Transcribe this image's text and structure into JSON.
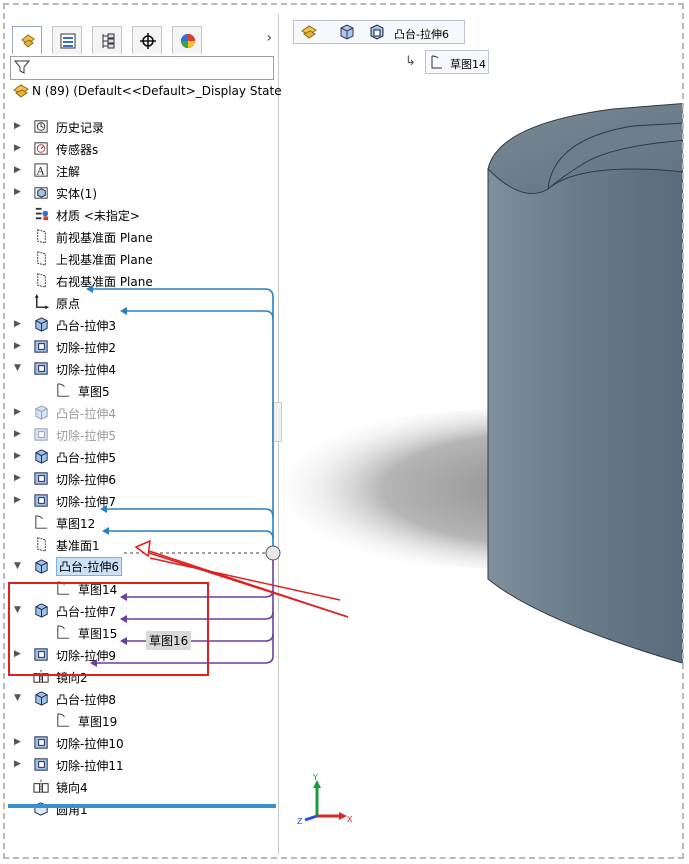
{
  "root": {
    "label": "N (89)  (Default<<Default>_Display State"
  },
  "tree": [
    {
      "label": "历史记录",
      "icon": "history-icon",
      "arrow": "right",
      "depth": 0
    },
    {
      "label": "传感器s",
      "icon": "sensor-icon",
      "arrow": "right",
      "depth": 0
    },
    {
      "label": "注解",
      "icon": "annotation-icon",
      "arrow": "right",
      "depth": 0
    },
    {
      "label": "实体(1)",
      "icon": "solid-body-icon",
      "arrow": "right",
      "depth": 0
    },
    {
      "label": "材质 <未指定>",
      "icon": "material-icon",
      "arrow": "none",
      "depth": 0
    },
    {
      "label": "前视基准面 Plane",
      "icon": "plane-icon",
      "arrow": "none",
      "depth": 0
    },
    {
      "label": "上视基准面 Plane",
      "icon": "plane-icon",
      "arrow": "none",
      "depth": 0
    },
    {
      "label": "右视基准面 Plane",
      "icon": "plane-icon",
      "arrow": "none",
      "depth": 0
    },
    {
      "label": "原点",
      "icon": "origin-icon",
      "arrow": "none",
      "depth": 0
    },
    {
      "label": "凸台-拉伸3",
      "icon": "boss-extrude-icon",
      "arrow": "right",
      "depth": 0
    },
    {
      "label": "切除-拉伸2",
      "icon": "cut-extrude-icon",
      "arrow": "right",
      "depth": 0
    },
    {
      "label": "切除-拉伸4",
      "icon": "cut-extrude-icon",
      "arrow": "down",
      "depth": 0
    },
    {
      "label": "草图5",
      "icon": "sketch-icon",
      "arrow": "none",
      "depth": 1
    },
    {
      "label": "凸台-拉伸4",
      "icon": "boss-extrude-icon",
      "arrow": "right",
      "depth": 0,
      "dim": true
    },
    {
      "label": "切除-拉伸5",
      "icon": "cut-extrude-icon",
      "arrow": "right",
      "depth": 0,
      "dim": true
    },
    {
      "label": "凸台-拉伸5",
      "icon": "boss-extrude-icon",
      "arrow": "right",
      "depth": 0
    },
    {
      "label": "切除-拉伸6",
      "icon": "cut-extrude-icon",
      "arrow": "right",
      "depth": 0
    },
    {
      "label": "切除-拉伸7",
      "icon": "cut-extrude-icon",
      "arrow": "right",
      "depth": 0
    },
    {
      "label": "草图12",
      "icon": "sketch-icon",
      "arrow": "none",
      "depth": 0
    },
    {
      "label": "基准面1",
      "icon": "plane-icon",
      "arrow": "none",
      "depth": 0
    },
    {
      "label": "凸台-拉伸6",
      "icon": "boss-extrude-icon",
      "arrow": "down",
      "depth": 0,
      "selected": true
    },
    {
      "label": "草图14",
      "icon": "sketch-icon",
      "arrow": "none",
      "depth": 1
    },
    {
      "label": "凸台-拉伸7",
      "icon": "boss-extrude-icon",
      "arrow": "down",
      "depth": 0
    },
    {
      "label": "草图15",
      "icon": "sketch-icon",
      "arrow": "none",
      "depth": 1
    },
    {
      "label": "切除-拉伸9",
      "icon": "cut-extrude-icon",
      "arrow": "right",
      "depth": 0
    },
    {
      "label": "镜向2",
      "icon": "mirror-icon",
      "arrow": "none",
      "depth": 0
    },
    {
      "label": "凸台-拉伸8",
      "icon": "boss-extrude-icon",
      "arrow": "down",
      "depth": 0
    },
    {
      "label": "草图19",
      "icon": "sketch-icon",
      "arrow": "none",
      "depth": 1
    },
    {
      "label": "切除-拉伸10",
      "icon": "cut-extrude-icon",
      "arrow": "right",
      "depth": 0
    },
    {
      "label": "切除-拉伸11",
      "icon": "cut-extrude-icon",
      "arrow": "right",
      "depth": 0
    },
    {
      "label": "镜向4",
      "icon": "mirror-icon",
      "arrow": "none",
      "depth": 0
    },
    {
      "label": "圆角1",
      "icon": "fillet-icon",
      "arrow": "none",
      "depth": 0
    }
  ],
  "tooltip": "草图16",
  "breadcrumb": {
    "feature": "凸台-拉伸6",
    "sketch": "草图14"
  },
  "triad": {
    "x": "X",
    "y": "Y",
    "z": "Z"
  },
  "colors": {
    "accent_blue": "#2a7fc1",
    "accent_purple": "#6a3fa0",
    "highlight_red": "#e02020",
    "selection_bg": "#c9e2f7"
  }
}
